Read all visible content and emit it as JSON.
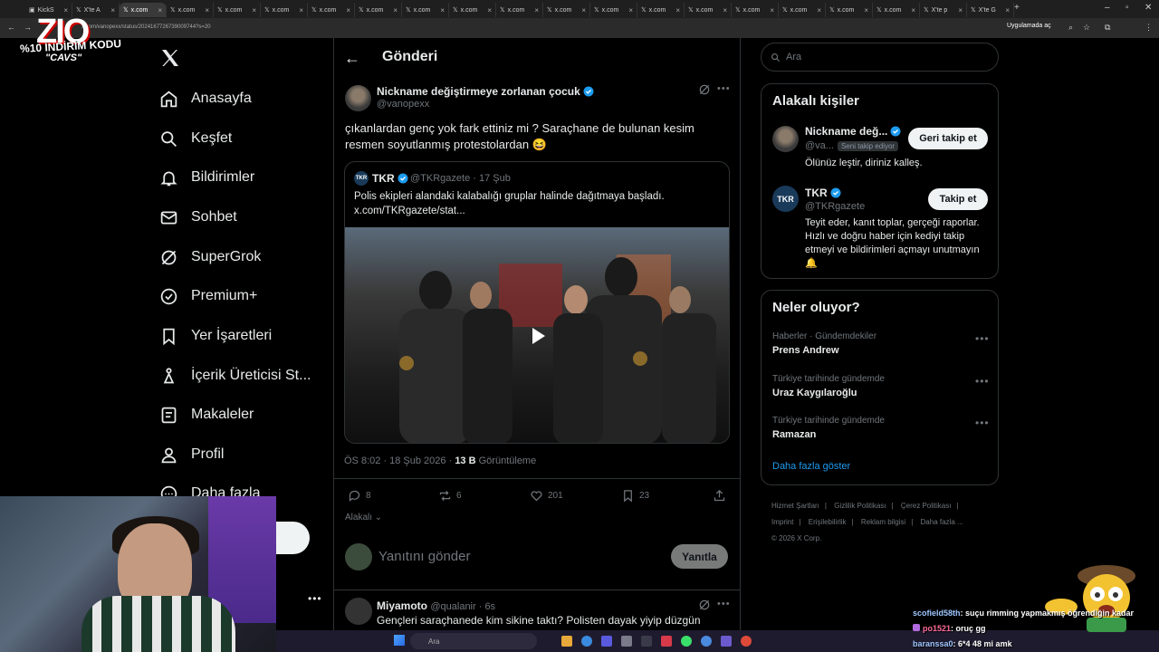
{
  "browser": {
    "tabs": [
      "KickS",
      "X'te A",
      "x.com",
      "x.com",
      "x.com",
      "x.com",
      "x.com",
      "x.com",
      "x.com",
      "x.com",
      "x.com",
      "x.com",
      "x.com",
      "x.com",
      "x.com",
      "x.com",
      "x.com",
      "x.com",
      "x.com",
      "X'te p",
      "X'te G"
    ],
    "url": "x.com/vanopexx/status/2024167726739009744?s=20",
    "open_in_app": "Uygulamada aç"
  },
  "overlay": {
    "logo_letters": "ZIO",
    "promo": "%10 İNDİRİM KODU",
    "code": "\"CAVS\""
  },
  "nav": {
    "items": [
      "Anasayfa",
      "Keşfet",
      "Bildirimler",
      "Sohbet",
      "SuperGrok",
      "Premium+",
      "Yer İşaretleri",
      "İçerik Üreticisi St...",
      "Makaleler",
      "Profil",
      "Daha fazla"
    ]
  },
  "header": {
    "title": "Gönderi"
  },
  "post": {
    "name": "Nickname değiştirmeye zorlanan çocuk",
    "handle": "@vanopexx",
    "text": "çıkanlardan genç yok fark ettiniz mi ? Saraçhane de bulunan kesim resmen soyutlanmış protestolardan 😆",
    "time": "ÖS 8:02 · 18 Şub 2026 ·",
    "views": "13 B",
    "views_label": "Görüntüleme",
    "replies": "8",
    "reposts": "6",
    "likes": "201",
    "bookmarks": "23",
    "relevant": "Alakalı"
  },
  "quote": {
    "avatar_text": "TKR",
    "name": "TKR",
    "handle": "@TKRgazete · 17 Şub",
    "text": "Polis ekipleri alandaki kalabalığı gruplar halinde dağıtmaya başladı. x.com/TKRgazete/stat..."
  },
  "reply": {
    "placeholder": "Yanıtını gönder",
    "button": "Yanıtla"
  },
  "comment": {
    "name": "Miyamoto",
    "handle": "@qualanir · 6s",
    "text": "Gençleri saraçhanede kim sikine taktı? Polisten dayak yiyip düzgün destek"
  },
  "search": {
    "placeholder": "Ara"
  },
  "relevant_people": {
    "title": "Alakalı kişiler",
    "people": [
      {
        "name": "Nickname değ...",
        "handle": "@va...",
        "badge": "Seni takip ediyor",
        "button": "Geri takip et",
        "bio": "Ölünüz leştir, diriniz kalleş."
      },
      {
        "name": "TKR",
        "handle": "@TKRgazete",
        "avatar_text": "TKR",
        "button": "Takip et",
        "bio": "Teyit eder, kanıt toplar, gerçeği raporlar. Hızlı ve doğru haber için kediyi takip etmeyi ve bildirimleri açmayı unutmayın🔔"
      }
    ]
  },
  "trends": {
    "title": "Neler oluyor?",
    "items": [
      {
        "category": "Haberler · Gündemdekiler",
        "name": "Prens Andrew"
      },
      {
        "category": "Türkiye tarihinde gündemde",
        "name": "Uraz Kaygılaroğlu"
      },
      {
        "category": "Türkiye tarihinde gündemde",
        "name": "Ramazan"
      }
    ],
    "show_more": "Daha fazla göster"
  },
  "footer": {
    "links": [
      "Hizmet Şartları",
      "Gizlilik Politikası",
      "Çerez Politikası",
      "Imprint",
      "Erişilebilirlik",
      "Reklam bilgisi",
      "Daha fazla ...",
      "© 2026 X Corp."
    ]
  },
  "taskbar": {
    "search": "Ara"
  },
  "chat": [
    {
      "user": "scofield58th",
      "text": ": suçu rimming yapmakmış öğrendiğin kadar"
    },
    {
      "user": "po1521",
      "text": ": oruç gg"
    },
    {
      "user": "baranssa0",
      "text": ": 6*4 48 mi amk"
    }
  ],
  "colors": {
    "accent": "#1d9bf0",
    "background": "#000000",
    "border": "#2f3336",
    "muted": "#71767b"
  }
}
